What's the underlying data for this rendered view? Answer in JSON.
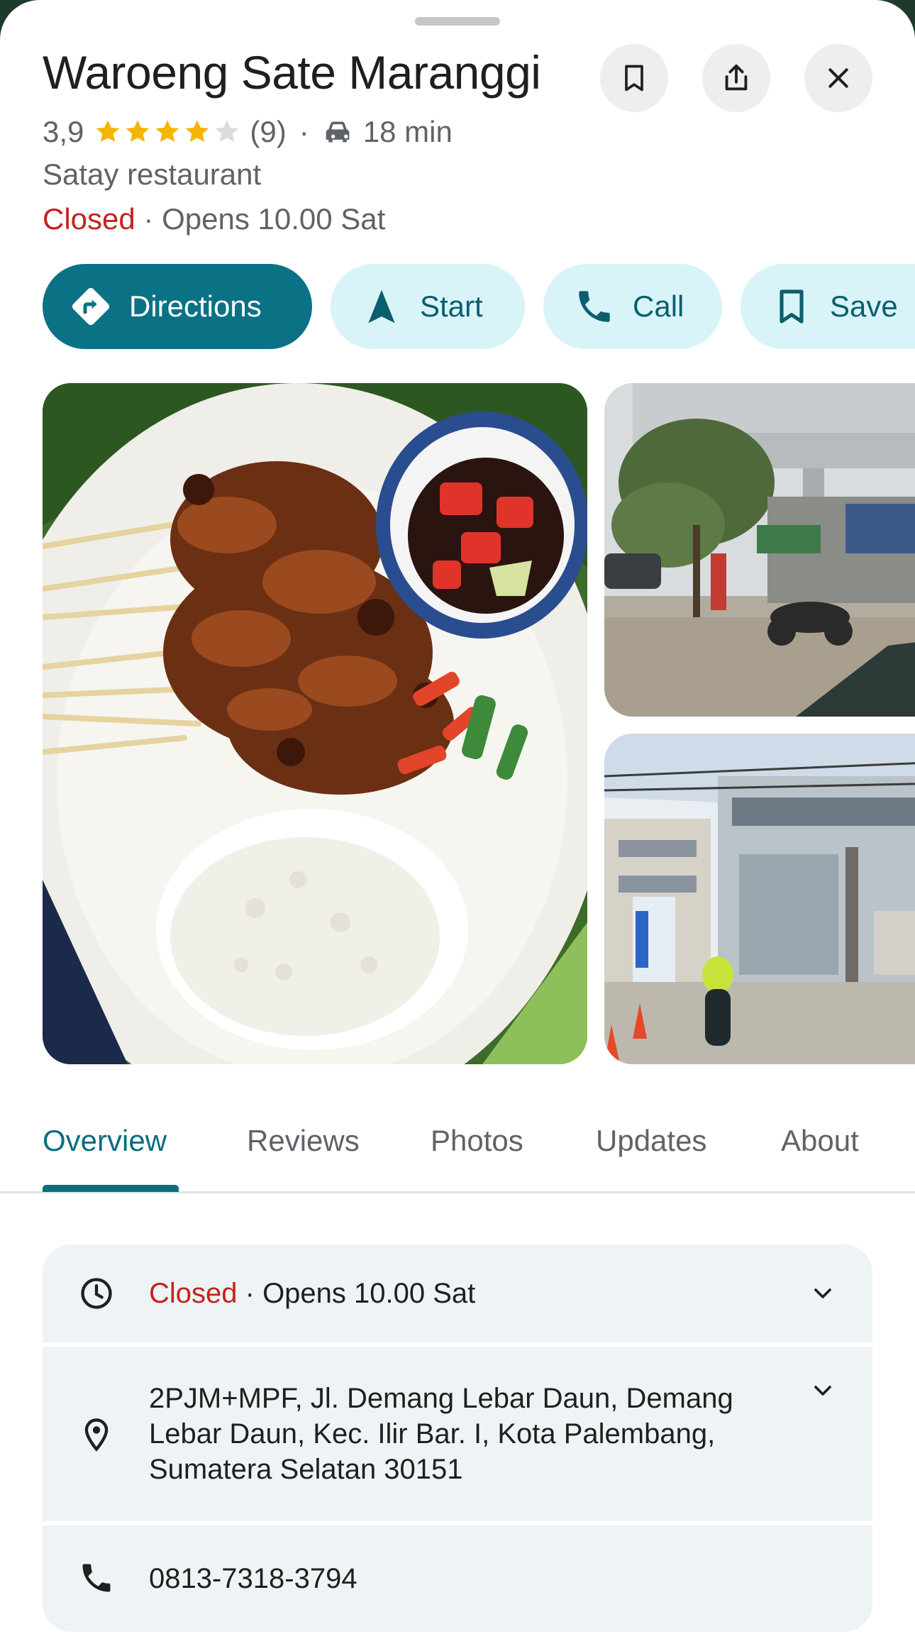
{
  "place": {
    "name": "Waroeng Sate Maranggi",
    "rating": "3,9",
    "rating_value": 3.9,
    "review_count": "(9)",
    "separator": "·",
    "travel_time": "18 min",
    "category": "Satay restaurant",
    "status_closed": "Closed",
    "status_opens": " · Opens 10.00 Sat"
  },
  "header_buttons": [
    {
      "name": "save-icon-button",
      "icon": "bookmark-icon"
    },
    {
      "name": "share-icon-button",
      "icon": "share-icon"
    },
    {
      "name": "close-button",
      "icon": "close-icon"
    }
  ],
  "actions": {
    "directions": "Directions",
    "start": "Start",
    "call": "Call",
    "save": "Save"
  },
  "tabs": [
    "Overview",
    "Reviews",
    "Photos",
    "Updates",
    "About"
  ],
  "active_tab": "Overview",
  "info": {
    "hours_closed": "Closed",
    "hours_opens": " · Opens 10.00 Sat",
    "address_line1": "2PJM+MPF, Jl. Demang Lebar Daun, Demang",
    "address_line2": "Lebar Daun, Kec. Ilir Bar. I, Kota Palembang,",
    "address_line3": "Sumatera Selatan 30151",
    "phone": "0813-7318-3794"
  },
  "colors": {
    "accent": "#0b7285",
    "accent_light": "#d9f4f8",
    "closed_red": "#c5221f",
    "star_gold": "#f6b400",
    "card_bg": "#eef4f5"
  }
}
